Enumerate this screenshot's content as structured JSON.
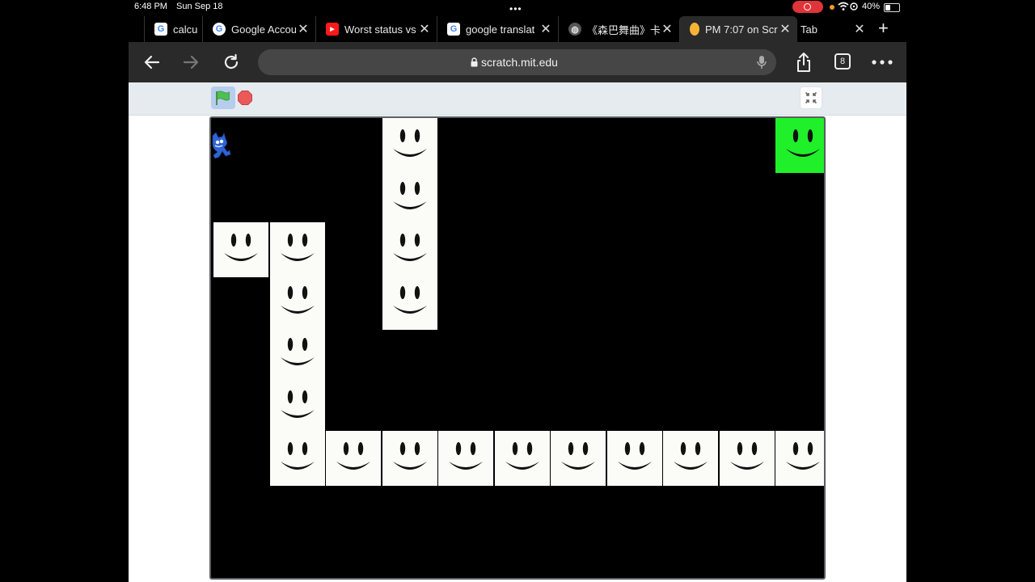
{
  "status": {
    "time": "6:48 PM",
    "date": "Sun Sep 18",
    "battery": "40%",
    "battery_level": 0.4
  },
  "tabs": [
    {
      "title": "calcu",
      "icon": "google-icon",
      "active": false
    },
    {
      "title": "Google Accoun",
      "icon": "google-icon",
      "active": false
    },
    {
      "title": "Worst status vs",
      "icon": "youtube-icon",
      "active": false
    },
    {
      "title": "google translat",
      "icon": "google-icon",
      "active": false
    },
    {
      "title": "《森巴舞曲》卡",
      "icon": "globe-icon",
      "active": false
    },
    {
      "title": "PM 7:07 on Scr",
      "icon": "scratch-icon",
      "active": true
    },
    {
      "title": "Tab",
      "icon": "",
      "active": false
    }
  ],
  "toolbar": {
    "url": "scratch.mit.edu",
    "tab_count": "8"
  },
  "colors": {
    "stage_bg": "#000000",
    "tile": "#fbfbf7",
    "goal_tile": "#1ff02a",
    "controls_bg": "#e6ebf0"
  },
  "game": {
    "goal_tile": {
      "col": 10,
      "row": 0
    },
    "tiles": [
      {
        "col": 3,
        "row": 0
      },
      {
        "col": 3,
        "row": 1
      },
      {
        "col": 3,
        "row": 2
      },
      {
        "col": 3,
        "row": 3
      },
      {
        "col": 0,
        "row": 2
      },
      {
        "col": 1,
        "row": 2
      },
      {
        "col": 1,
        "row": 3
      },
      {
        "col": 1,
        "row": 4
      },
      {
        "col": 1,
        "row": 5
      },
      {
        "col": 1,
        "row": 6
      },
      {
        "col": 2,
        "row": 6
      },
      {
        "col": 3,
        "row": 6
      },
      {
        "col": 4,
        "row": 6
      },
      {
        "col": 5,
        "row": 6
      },
      {
        "col": 6,
        "row": 6
      },
      {
        "col": 7,
        "row": 6
      },
      {
        "col": 8,
        "row": 6
      },
      {
        "col": 9,
        "row": 6
      },
      {
        "col": 10,
        "row": 6
      }
    ]
  }
}
